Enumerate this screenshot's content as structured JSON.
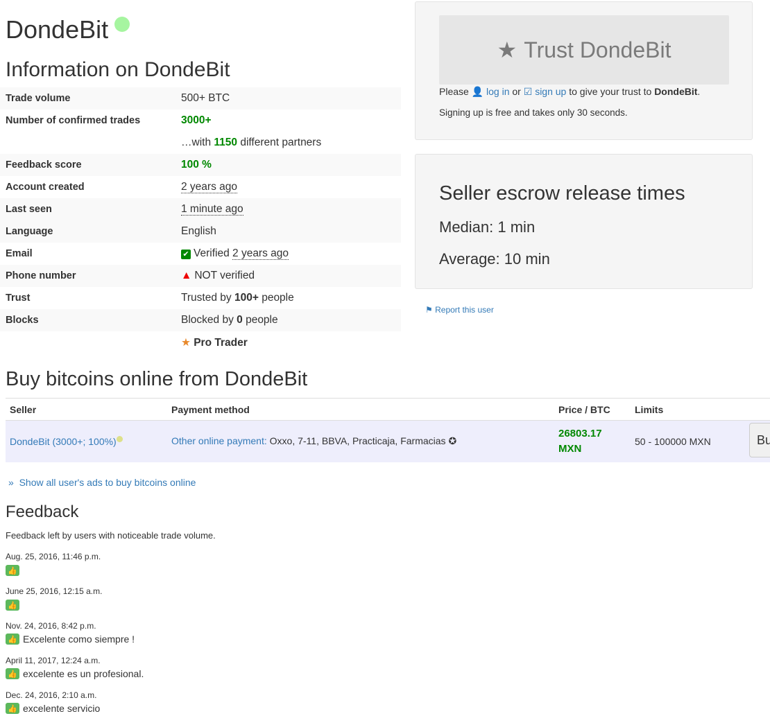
{
  "profile": {
    "name": "DondeBit",
    "info_title": "Information on DondeBit"
  },
  "info_rows": [
    {
      "label": "Trade volume",
      "value": "500+ BTC"
    },
    {
      "label": "Number of confirmed trades",
      "value": "3000+"
    },
    {
      "label": "",
      "prefix": "…with ",
      "value": "1150",
      "suffix": " different partners"
    },
    {
      "label": "Feedback score",
      "value": "100 %"
    },
    {
      "label": "Account created",
      "value": "2 years ago"
    },
    {
      "label": "Last seen",
      "value": "1 minute ago"
    },
    {
      "label": "Language",
      "value": "English"
    },
    {
      "label": "Email",
      "prefix": "Verified ",
      "value": "2 years ago"
    },
    {
      "label": "Phone number",
      "value": "NOT verified"
    },
    {
      "label": "Trust",
      "prefix": "Trusted by ",
      "value": "100+",
      "suffix": " people"
    },
    {
      "label": "Blocks",
      "prefix": "Blocked by ",
      "value": "0",
      "suffix": " people"
    },
    {
      "label": "",
      "value": "Pro Trader"
    }
  ],
  "trust": {
    "button": "Trust DondeBit",
    "please": "Please ",
    "login": "log in",
    "or": " or ",
    "signup": "sign up",
    "to_give": " to give your trust to ",
    "name": "DondeBit",
    "period": ".",
    "note": "Signing up is free and takes only 30 seconds."
  },
  "escrow": {
    "title": "Seller escrow release times",
    "median": "Median: 1 min",
    "average": "Average: 10 min"
  },
  "report": "Report this user",
  "ads": {
    "title": "Buy bitcoins online from DondeBit",
    "headers": [
      "Seller",
      "Payment method",
      "Price / BTC",
      "Limits"
    ],
    "row": {
      "seller": "DondeBit (3000+; 100%)",
      "method": "Other online payment:",
      "method_detail": " Oxxo, 7-11, BBVA, Practicaja, Farmacias",
      "price": "26803.17",
      "currency": "MXN",
      "limits": "50 - 100000 MXN",
      "buy": "Buy"
    },
    "show_all": "Show all user's ads to buy bitcoins online"
  },
  "feedback": {
    "title": "Feedback",
    "subtitle": "Feedback left by users with noticeable trade volume.",
    "items": [
      {
        "date": "Aug. 25, 2016, 11:46 p.m.",
        "text": ""
      },
      {
        "date": "June 25, 2016, 12:15 a.m.",
        "text": ""
      },
      {
        "date": "Nov. 24, 2016, 8:42 p.m.",
        "text": "Excelente como siempre !"
      },
      {
        "date": "April 11, 2017, 12:24 a.m.",
        "text": "excelente es un profesional."
      },
      {
        "date": "Dec. 24, 2016, 2:10 a.m.",
        "text": "excelente servicio"
      }
    ]
  },
  "colors": {
    "green": "#008800",
    "link": "#337ab7",
    "thumb": "#5cb85c",
    "online": "#a6f5a0"
  }
}
